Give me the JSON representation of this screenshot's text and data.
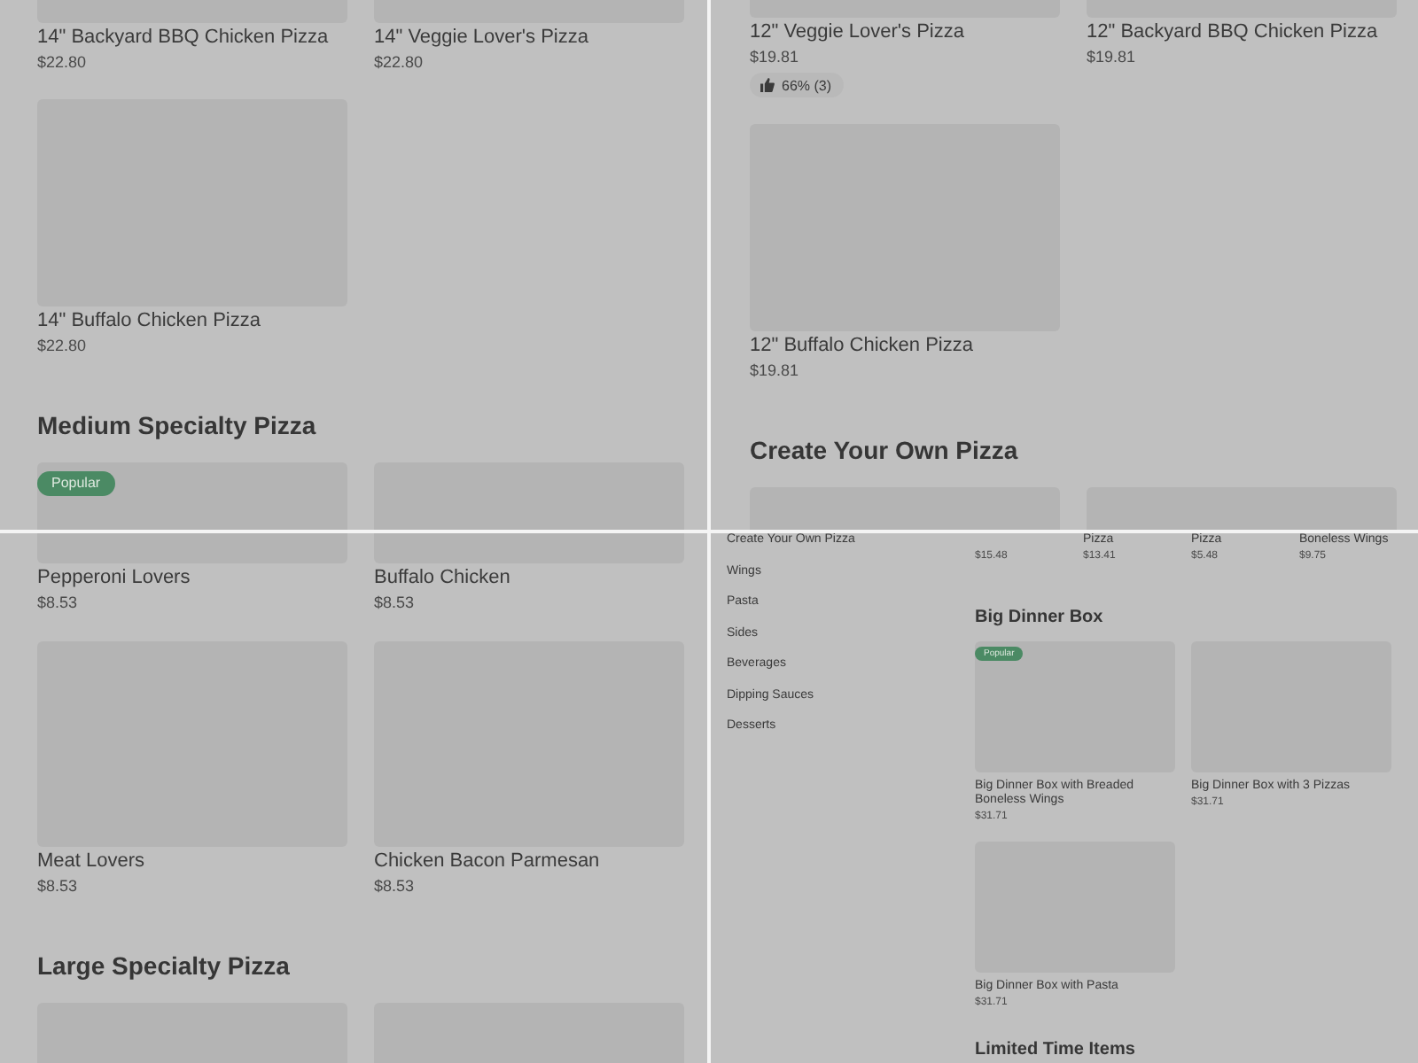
{
  "views": [
    {
      "kind": "desktop",
      "sections": [
        {
          "items": [
            {
              "kind": "product",
              "name": "14\" Backyard BBQ Chicken Pizza",
              "price": "$22.80"
            },
            {
              "kind": "product",
              "name": "14\" Veggie Lover's Pizza",
              "price": "$22.80"
            },
            {
              "kind": "product",
              "name": "14\" Buffalo Chicken Pizza",
              "price": "$22.80"
            }
          ]
        },
        {
          "heading": "Medium Specialty Pizza",
          "items": [
            {
              "kind": "picture",
              "badge": "Popular"
            },
            {
              "kind": "picture"
            }
          ]
        }
      ]
    },
    {
      "kind": "desktop",
      "sections": [
        {
          "items": [
            {
              "kind": "product",
              "name": "12\" Veggie Lover's Pizza",
              "price": "$19.81",
              "rating": "66% (3)"
            },
            {
              "kind": "product",
              "name": "12\" Backyard BBQ Chicken Pizza",
              "price": "$19.81"
            },
            {
              "kind": "product",
              "name": "12\" Buffalo Chicken Pizza",
              "price": "$19.81"
            }
          ]
        },
        {
          "heading": "Create Your Own Pizza",
          "items": [
            {
              "kind": "picture"
            },
            {
              "kind": "picture"
            }
          ]
        }
      ]
    },
    {
      "kind": "desktop",
      "sections": [
        {
          "items": [
            {
              "kind": "product",
              "name": "Pepperoni Lovers",
              "price": "$8.53"
            },
            {
              "kind": "product",
              "name": "Buffalo Chicken",
              "price": "$8.53"
            },
            {
              "kind": "product",
              "name": "Meat Lovers",
              "price": "$8.53"
            },
            {
              "kind": "product",
              "name": "Chicken Bacon Parmesan",
              "price": "$8.53"
            }
          ]
        },
        {
          "heading": "Large Specialty Pizza",
          "items": [
            {
              "kind": "picture"
            },
            {
              "kind": "picture"
            }
          ]
        }
      ]
    },
    {
      "kind": "compact",
      "sidebar": [
        "Create Your Own Pizza",
        "Wings",
        "Pasta",
        "Sides",
        "Beverages",
        "Dipping Sauces",
        "Desserts"
      ],
      "sections": [
        {
          "items": [
            {
              "kind": "product",
              "price": "$15.48"
            },
            {
              "kind": "product",
              "name": "Pizza",
              "price": "$13.41"
            },
            {
              "kind": "product",
              "name": "Pizza",
              "price": "$5.48"
            },
            {
              "kind": "product",
              "name": "Boneless Wings",
              "price": "$9.75"
            }
          ]
        },
        {
          "heading": "Big Dinner Box",
          "items": [
            {
              "kind": "product",
              "name": "Big Dinner Box with Breaded Boneless Wings",
              "price": "$31.71",
              "badge": "Popular"
            },
            {
              "kind": "product",
              "name": "Big Dinner Box with 3 Pizzas",
              "price": "$31.71"
            },
            {
              "kind": "product",
              "name": "Big Dinner Box with Pasta",
              "price": "$31.71"
            }
          ]
        },
        {
          "heading": "Limited Time Items"
        }
      ]
    }
  ]
}
